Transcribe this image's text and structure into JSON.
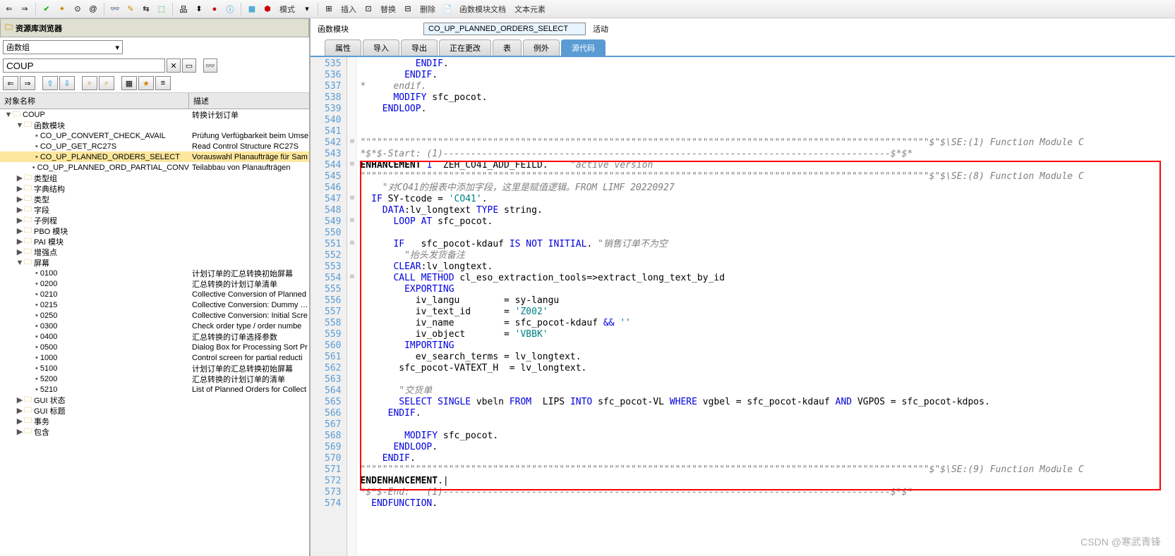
{
  "toolbar": {
    "labels": {
      "mode": "模式",
      "insert": "插入",
      "replace": "替换",
      "delete": "删除",
      "fndoc": "函数模块文档",
      "textelem": "文本元素"
    }
  },
  "leftPanel": {
    "title": "资源库浏览器",
    "fgLabel": "函数组",
    "fgValue": "COUP",
    "headers": {
      "name": "对象名称",
      "desc": "描述"
    },
    "tree": [
      {
        "lvl": 0,
        "exp": "▼",
        "ic": "folder",
        "name": "COUP",
        "desc": "转换计划订单"
      },
      {
        "lvl": 1,
        "exp": "▼",
        "ic": "folder",
        "name": "函数模块",
        "desc": ""
      },
      {
        "lvl": 2,
        "exp": "",
        "ic": "dot",
        "name": "CO_UP_CONVERT_CHECK_AVAIL",
        "desc": "Prüfung Verfügbarkeit beim Umse"
      },
      {
        "lvl": 2,
        "exp": "",
        "ic": "dot",
        "name": "CO_UP_GET_RC27S",
        "desc": "Read Control Structure RC27S"
      },
      {
        "lvl": 2,
        "exp": "",
        "ic": "dot",
        "name": "CO_UP_PLANNED_ORDERS_SELECT",
        "desc": "Vorauswahl Planaufträge für Sam",
        "sel": true
      },
      {
        "lvl": 2,
        "exp": "",
        "ic": "dot",
        "name": "CO_UP_PLANNED_ORD_PARTIAL_CONV",
        "desc": "Teilabbau von Planaufträgen"
      },
      {
        "lvl": 1,
        "exp": "▶",
        "ic": "folder",
        "name": "类型组",
        "desc": ""
      },
      {
        "lvl": 1,
        "exp": "▶",
        "ic": "folder",
        "name": "字典结构",
        "desc": ""
      },
      {
        "lvl": 1,
        "exp": "▶",
        "ic": "folder",
        "name": "类型",
        "desc": ""
      },
      {
        "lvl": 1,
        "exp": "▶",
        "ic": "folder",
        "name": "字段",
        "desc": ""
      },
      {
        "lvl": 1,
        "exp": "▶",
        "ic": "folder",
        "name": "子例程",
        "desc": ""
      },
      {
        "lvl": 1,
        "exp": "▶",
        "ic": "folder",
        "name": "PBO 模块",
        "desc": ""
      },
      {
        "lvl": 1,
        "exp": "▶",
        "ic": "folder",
        "name": "PAI 模块",
        "desc": ""
      },
      {
        "lvl": 1,
        "exp": "▶",
        "ic": "folder",
        "name": "增强点",
        "desc": ""
      },
      {
        "lvl": 1,
        "exp": "▼",
        "ic": "folder",
        "name": "屏幕",
        "desc": ""
      },
      {
        "lvl": 2,
        "exp": "",
        "ic": "dot",
        "name": "0100",
        "desc": "计划订单的汇总转换初始屏幕"
      },
      {
        "lvl": 2,
        "exp": "",
        "ic": "dot",
        "name": "0200",
        "desc": "汇总转换的计划订单清单"
      },
      {
        "lvl": 2,
        "exp": "",
        "ic": "dot",
        "name": "0210",
        "desc": "Collective Conversion of Planned"
      },
      {
        "lvl": 2,
        "exp": "",
        "ic": "dot",
        "name": "0215",
        "desc": "Collective Conversion: Dummy Su"
      },
      {
        "lvl": 2,
        "exp": "",
        "ic": "dot",
        "name": "0250",
        "desc": "Collective Conversion: Initial Scre"
      },
      {
        "lvl": 2,
        "exp": "",
        "ic": "dot",
        "name": "0300",
        "desc": "Check order  type / order numbe"
      },
      {
        "lvl": 2,
        "exp": "",
        "ic": "dot",
        "name": "0400",
        "desc": "汇总转换的订单选择参数"
      },
      {
        "lvl": 2,
        "exp": "",
        "ic": "dot",
        "name": "0500",
        "desc": "Dialog Box for Processing Sort Pr"
      },
      {
        "lvl": 2,
        "exp": "",
        "ic": "dot",
        "name": "1000",
        "desc": "Control screen for partial reducti"
      },
      {
        "lvl": 2,
        "exp": "",
        "ic": "dot",
        "name": "5100",
        "desc": "计划订单的汇总转换初始屏幕"
      },
      {
        "lvl": 2,
        "exp": "",
        "ic": "dot",
        "name": "5200",
        "desc": "汇总转换的计划订单的清单"
      },
      {
        "lvl": 2,
        "exp": "",
        "ic": "dot",
        "name": "5210",
        "desc": "List of Planned Orders for Collect"
      },
      {
        "lvl": 1,
        "exp": "▶",
        "ic": "folder",
        "name": "GUI 状态",
        "desc": ""
      },
      {
        "lvl": 1,
        "exp": "▶",
        "ic": "folder",
        "name": "GUI 标题",
        "desc": ""
      },
      {
        "lvl": 1,
        "exp": "▶",
        "ic": "folder",
        "name": "事务",
        "desc": ""
      },
      {
        "lvl": 1,
        "exp": "▶",
        "ic": "folder",
        "name": "包含",
        "desc": ""
      }
    ]
  },
  "rightPanel": {
    "fmLabel": "函数模块",
    "fmValue": "CO_UP_PLANNED_ORDERS_SELECT",
    "status": "活动",
    "tabs": [
      "属性",
      "导入",
      "导出",
      "正在更改",
      "表",
      "例外",
      "源代码"
    ],
    "activeTab": 6
  },
  "code": {
    "startLine": 535,
    "lines": [
      {
        "t": "          <kw>ENDIF</kw>."
      },
      {
        "t": "        <kw>ENDIF</kw>."
      },
      {
        "t": "<cmt>*     endif.</cmt>"
      },
      {
        "t": "      <kw>MODIFY</kw> sfc_pocot."
      },
      {
        "t": "    <kw>ENDLOOP</kw>."
      },
      {
        "t": ""
      },
      {
        "t": ""
      },
      {
        "t": "<cmt>\"\"\"\"\"\"\"\"\"\"\"\"\"\"\"\"\"\"\"\"\"\"\"\"\"\"\"\"\"\"\"\"\"\"\"\"\"\"\"\"\"\"\"\"\"\"\"\"\"\"\"\"\"\"\"\"\"\"\"\"\"\"\"\"\"\"\"\"\"\"\"\"\"\"\"\"\"\"\"\"\"\"\"\"\"\"\"\"\"\"\"\"\"\"\"\"\"\"\"\"\"\"\"$\"$\\SE:(1) Function Module C</cmt>"
      },
      {
        "t": "<cmt>*$*$-Start: (1)---------------------------------------------------------------------------------$*$*</cmt>"
      },
      {
        "t": "<bold>ENHANCEMENT</bold> <kw>1</kw>  ZEH_CO41_ADD_FEILD.    <cmt>\"active version</cmt>"
      },
      {
        "t": "<cmt>\"\"\"\"\"\"\"\"\"\"\"\"\"\"\"\"\"\"\"\"\"\"\"\"\"\"\"\"\"\"\"\"\"\"\"\"\"\"\"\"\"\"\"\"\"\"\"\"\"\"\"\"\"\"\"\"\"\"\"\"\"\"\"\"\"\"\"\"\"\"\"\"\"\"\"\"\"\"\"\"\"\"\"\"\"\"\"\"\"\"\"\"\"\"\"\"\"\"\"\"\"\"\"$\"$\\SE:(8) Function Module C</cmt>"
      },
      {
        "t": "    <cmt>\"对CO41的报表中添加字段，这里是赋值逻辑。FROM LIMF 20220927</cmt>"
      },
      {
        "t": "  <kw>IF</kw> SY-tcode = <str>'CO41'</str>."
      },
      {
        "t": "    <kw>DATA</kw>:lv_longtext <kw>TYPE</kw> string."
      },
      {
        "t": "      <kw>LOOP AT</kw> sfc_pocot."
      },
      {
        "t": ""
      },
      {
        "t": "      <kw>IF</kw>   sfc_pocot-kdauf <kw>IS NOT INITIAL</kw>. <cmt>\"销售订单不为空</cmt>"
      },
      {
        "t": "        <cmt>\"抬头发货备注</cmt>"
      },
      {
        "t": "      <kw>CLEAR</kw>:lv_longtext."
      },
      {
        "t": "      <kw>CALL METHOD</kw> cl_eso_extraction_tools=>extract_long_text_by_id"
      },
      {
        "t": "        <kw>EXPORTING</kw>"
      },
      {
        "t": "          iv_langu        = sy-langu"
      },
      {
        "t": "          iv_text_id      = <str>'Z002'</str>"
      },
      {
        "t": "          iv_name         = sfc_pocot-kdauf <kw>&&</kw> <str>''</str>"
      },
      {
        "t": "          iv_object       = <str>'VBBK'</str>"
      },
      {
        "t": "        <kw>IMPORTING</kw>"
      },
      {
        "t": "          ev_search_terms = lv_longtext."
      },
      {
        "t": "       sfc_pocot-VATEXT_H  = lv_longtext."
      },
      {
        "t": ""
      },
      {
        "t": "       <cmt>\"交货单</cmt>"
      },
      {
        "t": "       <kw>SELECT SINGLE</kw> vbeln <kw>FROM</kw>  LIPS <kw>INTO</kw> sfc_pocot-VL <kw>WHERE</kw> vgbel = sfc_pocot-kdauf <kw>AND</kw> VGPOS = sfc_pocot-kdpos."
      },
      {
        "t": "     <kw>ENDIF</kw>."
      },
      {
        "t": ""
      },
      {
        "t": "        <kw>MODIFY</kw> sfc_pocot."
      },
      {
        "t": "      <kw>ENDLOOP</kw>."
      },
      {
        "t": "    <kw>ENDIF</kw>."
      },
      {
        "t": "<cmt>\"\"\"\"\"\"\"\"\"\"\"\"\"\"\"\"\"\"\"\"\"\"\"\"\"\"\"\"\"\"\"\"\"\"\"\"\"\"\"\"\"\"\"\"\"\"\"\"\"\"\"\"\"\"\"\"\"\"\"\"\"\"\"\"\"\"\"\"\"\"\"\"\"\"\"\"\"\"\"\"\"\"\"\"\"\"\"\"\"\"\"\"\"\"\"\"\"\"\"\"\"\"\"$\"$\\SE:(9) Function Module C</cmt>"
      },
      {
        "t": "<bold>ENDENHANCEMENT</bold>.|"
      },
      {
        "t": "<cmt>*$*$-End:   (1)---------------------------------------------------------------------------------$*$*</cmt>"
      },
      {
        "t": "  <kw>ENDFUNCTION</kw>."
      }
    ],
    "foldMarks": {
      "542": "⊟",
      "544": "⊟",
      "547": "⊟",
      "549": "⊟",
      "551": "⊟",
      "554": "⊟"
    }
  },
  "watermark": "CSDN @寒武青锋"
}
